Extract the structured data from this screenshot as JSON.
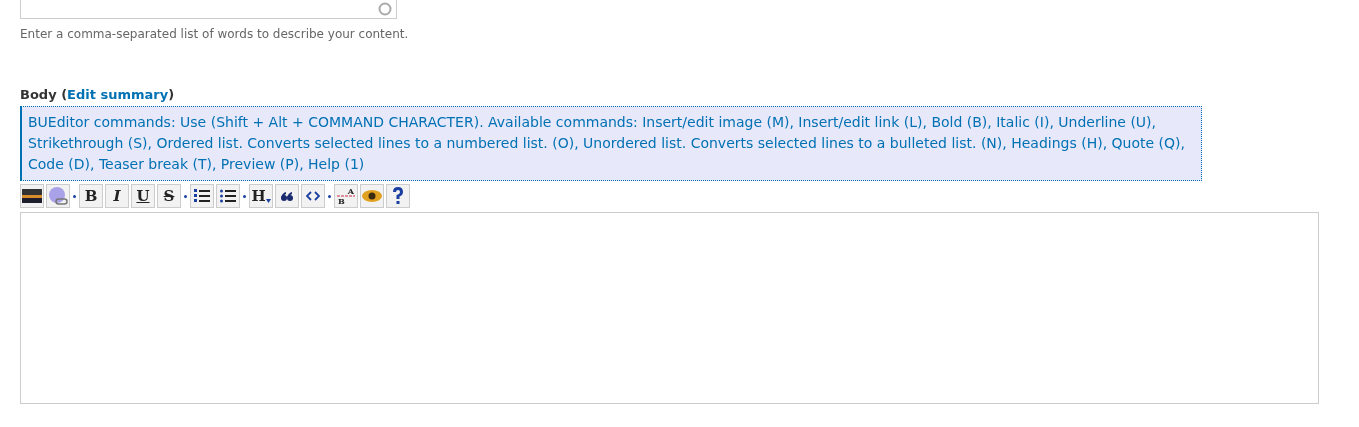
{
  "tags_field": {
    "throbber": true
  },
  "tags_help": "Enter a comma-separated list of words to describe your content.",
  "body": {
    "label": "Body",
    "open": "(",
    "link": "Edit summary",
    "close": ")"
  },
  "editor_help": "BUEditor commands: Use (Shift + Alt + COMMAND CHARACTER). Available commands: Insert/edit image (M), Insert/edit link (L), Bold (B), Italic (I), Underline (U), Strikethrough (S), Ordered list. Converts selected lines to a numbered list. (O), Unordered list. Converts selected lines to a bulleted list. (N), Headings (H), Quote (Q), Code (D), Teaser break (T), Preview (P), Help (1)",
  "toolbar": [
    {
      "kind": "image"
    },
    {
      "kind": "link"
    },
    {
      "kind": "sep"
    },
    {
      "kind": "bold",
      "label": "B"
    },
    {
      "kind": "italic",
      "label": "I"
    },
    {
      "kind": "underline",
      "label": "U"
    },
    {
      "kind": "strike",
      "label": "S"
    },
    {
      "kind": "sep"
    },
    {
      "kind": "ol"
    },
    {
      "kind": "ul"
    },
    {
      "kind": "sep"
    },
    {
      "kind": "heading",
      "label": "H"
    },
    {
      "kind": "quote"
    },
    {
      "kind": "code"
    },
    {
      "kind": "sep"
    },
    {
      "kind": "teaser",
      "label": "A",
      "sublabel": "B"
    },
    {
      "kind": "preview"
    },
    {
      "kind": "help"
    }
  ]
}
